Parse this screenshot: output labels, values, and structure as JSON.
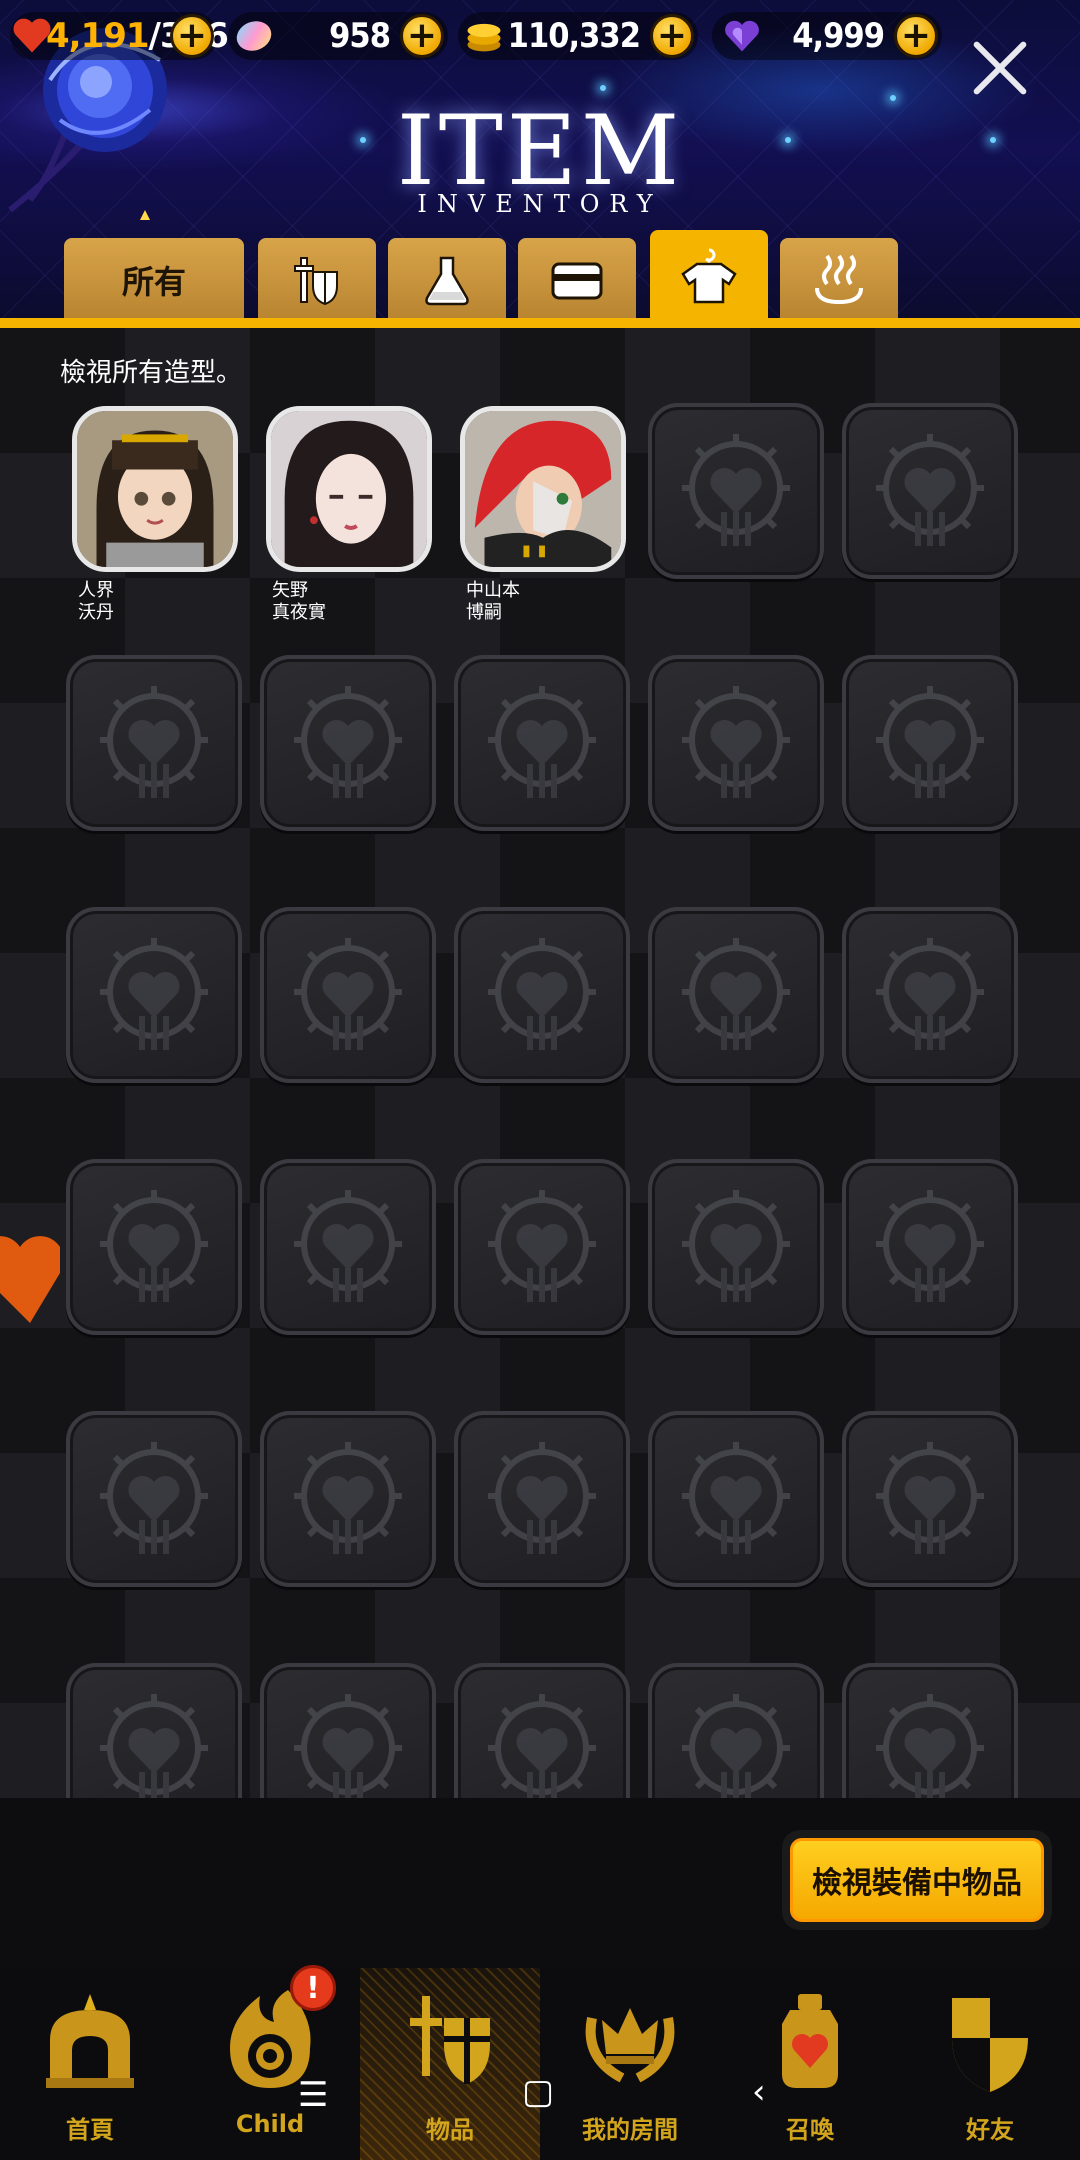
{
  "currencies": {
    "stamina": {
      "current": "4,191",
      "max": "/346",
      "icon": "heart-icon"
    },
    "gems": {
      "value": "958",
      "icon": "rainbow-crystal-icon"
    },
    "gold": {
      "value": "110,332",
      "icon": "gold-coins-icon"
    },
    "hearts": {
      "value": "4,999",
      "icon": "purple-heart-gem-icon"
    },
    "add_symbol": "+"
  },
  "header": {
    "title": "ITEM",
    "subtitle": "INVENTORY"
  },
  "tabs": [
    {
      "label": "所有",
      "icon": "",
      "active": false
    },
    {
      "label": "",
      "icon": "knight-armor-icon",
      "active": false
    },
    {
      "label": "",
      "icon": "potion-flask-icon",
      "active": false
    },
    {
      "label": "",
      "icon": "card-icon",
      "active": false
    },
    {
      "label": "",
      "icon": "shirt-hanger-icon",
      "active": true
    },
    {
      "label": "",
      "icon": "hot-spring-icon",
      "active": false
    }
  ],
  "content": {
    "hint": "檢視所有造型。",
    "characters": [
      {
        "line1": "人界",
        "line2": "沃丹"
      },
      {
        "line1": "矢野",
        "line2": "真夜實"
      },
      {
        "line1": "中山本",
        "line2": "博嗣"
      }
    ],
    "empty_slot_icon": "locked-heart-emblem-icon"
  },
  "equip_button": {
    "label": "檢視裝備中物品"
  },
  "bottom_nav": [
    {
      "label": "首頁",
      "icon": "home-arch-icon",
      "active": false
    },
    {
      "label": "Child",
      "icon": "child-flame-icon",
      "active": false
    },
    {
      "label": "物品",
      "icon": "sword-shield-icon",
      "active": true
    },
    {
      "label": "我的房間",
      "icon": "crown-laurel-icon",
      "active": false
    },
    {
      "label": "召喚",
      "icon": "summon-bottle-icon",
      "active": false
    },
    {
      "label": "好友",
      "icon": "checkered-shield-icon",
      "active": false
    }
  ],
  "alert": {
    "symbol": "!"
  },
  "colors": {
    "accent": "#f5b400",
    "nav_label": "#d3a51c",
    "alert": "#e63a1c"
  }
}
